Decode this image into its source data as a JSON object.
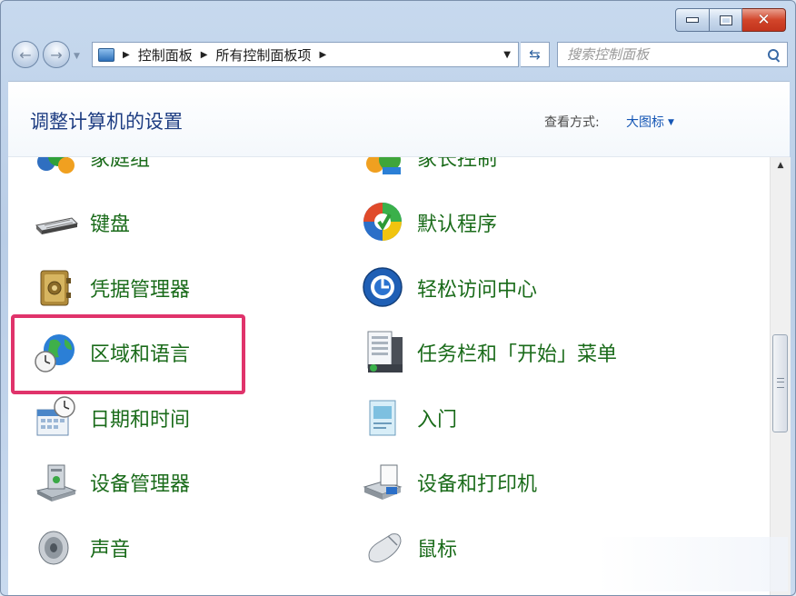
{
  "window": {
    "caption_buttons": [
      "minimize",
      "maximize",
      "close"
    ],
    "close_glyph": "✕"
  },
  "nav": {
    "breadcrumb": [
      "控制面板",
      "所有控制面板项"
    ],
    "search_placeholder": "搜索控制面板"
  },
  "header": {
    "title": "调整计算机的设置",
    "view_by_label": "查看方式:",
    "view_by_value": "大图标"
  },
  "items_left": [
    {
      "label": "家庭组",
      "icon": "homegroup-icon"
    },
    {
      "label": "键盘",
      "icon": "keyboard-icon"
    },
    {
      "label": "凭据管理器",
      "icon": "credential-manager-icon"
    },
    {
      "label": "区域和语言",
      "icon": "region-language-icon"
    },
    {
      "label": "日期和时间",
      "icon": "date-time-icon"
    },
    {
      "label": "设备管理器",
      "icon": "device-manager-icon"
    },
    {
      "label": "声音",
      "icon": "sound-icon"
    }
  ],
  "items_right": [
    {
      "label": "家长控制",
      "icon": "parental-controls-icon"
    },
    {
      "label": "默认程序",
      "icon": "default-programs-icon"
    },
    {
      "label": "轻松访问中心",
      "icon": "ease-of-access-icon"
    },
    {
      "label": "任务栏和「开始」菜单",
      "icon": "taskbar-start-menu-icon"
    },
    {
      "label": "入门",
      "icon": "getting-started-icon"
    },
    {
      "label": "设备和打印机",
      "icon": "devices-printers-icon"
    },
    {
      "label": "鼠标",
      "icon": "mouse-icon"
    }
  ],
  "colors": {
    "link_green": "#1a6b1a",
    "title_blue": "#1e3d82",
    "highlight": "#e0336b"
  }
}
